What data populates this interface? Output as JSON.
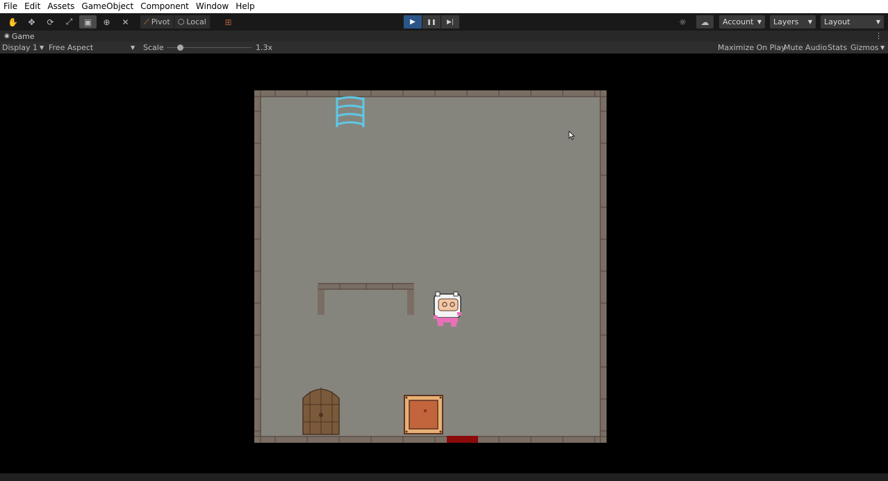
{
  "menu": {
    "items": [
      "File",
      "Edit",
      "Assets",
      "GameObject",
      "Component",
      "Window",
      "Help"
    ]
  },
  "toolbar": {
    "tools": [
      {
        "icon": "hand-icon",
        "glyph": "✋"
      },
      {
        "icon": "move-icon",
        "glyph": "✥"
      },
      {
        "icon": "rotate-icon",
        "glyph": "⟳"
      },
      {
        "icon": "scale-icon",
        "glyph": "⤢"
      },
      {
        "icon": "rect-icon",
        "glyph": "▣"
      },
      {
        "icon": "transform-icon",
        "glyph": "⊕"
      },
      {
        "icon": "custom-tool-icon",
        "glyph": "✕"
      }
    ],
    "pivot_label": "Pivot",
    "local_label": "Local",
    "play_glyph": "▶",
    "pause_glyph": "❚❚",
    "step_glyph": "▶|",
    "account_label": "Account",
    "layers_label": "Layers",
    "layout_label": "Layout"
  },
  "tab": {
    "label": "Game"
  },
  "game_bar": {
    "display_label": "Display 1",
    "aspect_label": "Free Aspect",
    "scale_label": "Scale",
    "scale_value": "1.3x",
    "maximize_label": "Maximize On Play",
    "mute_label": "Mute Audio",
    "stats_label": "Stats",
    "gizmos_label": "Gizmos"
  },
  "colors": {
    "play_active": "#2a5586",
    "room_floor": "#85857d",
    "room_wall": "#7a6e64",
    "ladder": "#5ec8e6",
    "exit_marker": "#8b0a0a"
  }
}
